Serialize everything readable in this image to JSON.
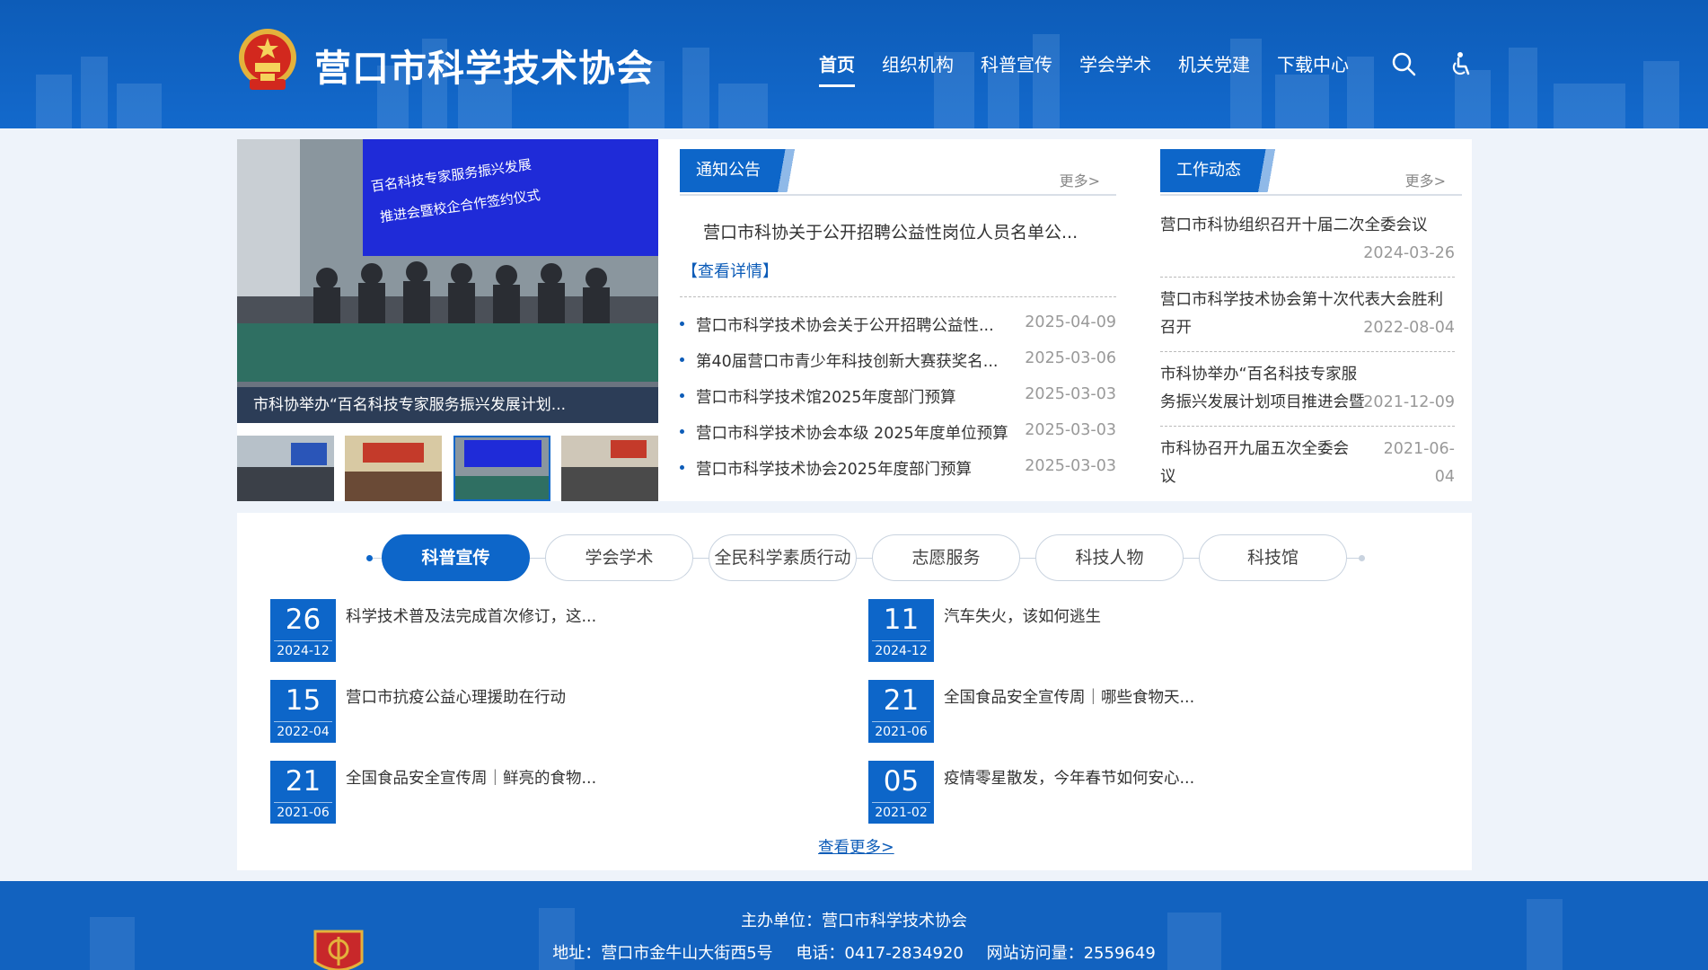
{
  "header": {
    "site_title": "营口市科学技术协会",
    "nav": [
      "首页",
      "组织机构",
      "科普宣传",
      "学会学术",
      "机关党建",
      "下载中心"
    ],
    "search_icon": "search-icon",
    "accessibility_icon": "accessibility-icon"
  },
  "slider": {
    "caption": "市科协举办“百名科技专家服务振兴发展计划...",
    "screen_text_1": "百名科技专家服务振兴发展",
    "screen_text_2": "推进会暨校企合作签约仪式"
  },
  "notice": {
    "title": "通知公告",
    "more": "更多>",
    "featured": "营口市科协关于公开招聘公益性岗位人员名单公...",
    "detail": "【查看详情】",
    "items": [
      {
        "title": "营口市科学技术协会关于公开招聘公益性...",
        "date": "2025-04-09"
      },
      {
        "title": "第40届营口市青少年科技创新大赛获奖名...",
        "date": "2025-03-06"
      },
      {
        "title": "营口市科学技术馆2025年度部门预算",
        "date": "2025-03-03"
      },
      {
        "title": "营口市科学技术协会本级 2025年度单位预算",
        "date": "2025-03-03"
      },
      {
        "title": "营口市科学技术协会2025年度部门预算",
        "date": "2025-03-03"
      }
    ]
  },
  "work": {
    "title": "工作动态",
    "more": "更多>",
    "items": [
      {
        "title": "营口市科协组织召开十届二次全委会议",
        "date": "2024-03-26"
      },
      {
        "title": "营口市科学技术协会第十次代表大会胜利召开",
        "date": "2022-08-04"
      },
      {
        "title": "市科协举办“百名科技专家服务振兴发展计划项目推进会暨校企合作...",
        "date": "2021-12-09"
      },
      {
        "title": "市科协召开九届五次全委会议",
        "date": "2021-06-04"
      }
    ]
  },
  "tabs": [
    "科普宣传",
    "学会学术",
    "全民科学素质行动",
    "志愿服务",
    "科技人物",
    "科技馆"
  ],
  "news": [
    {
      "day": "26",
      "ym": "2024-12",
      "title": "科学技术普及法完成首次修订，这..."
    },
    {
      "day": "11",
      "ym": "2024-12",
      "title": "汽车失火，该如何逃生"
    },
    {
      "day": "15",
      "ym": "2022-04",
      "title": "营口市抗疫公益心理援助在行动"
    },
    {
      "day": "21",
      "ym": "2021-06",
      "title": "全国食品安全宣传周｜哪些食物天..."
    },
    {
      "day": "21",
      "ym": "2021-06",
      "title": "全国食品安全宣传周｜鲜亮的食物..."
    },
    {
      "day": "05",
      "ym": "2021-02",
      "title": "疫情零星散发，今年春节如何安心..."
    }
  ],
  "view_more": "查看更多>",
  "footer": {
    "sponsor": "主办单位：营口市科学技术协会",
    "address": "地址：营口市金牛山大街西5号",
    "phone": "电话：0417-2834920",
    "visits": "网站访问量：2559649"
  },
  "colors": {
    "primary": "#0d66c9",
    "header": "#0d5cb8",
    "footer": "#1262bf"
  }
}
